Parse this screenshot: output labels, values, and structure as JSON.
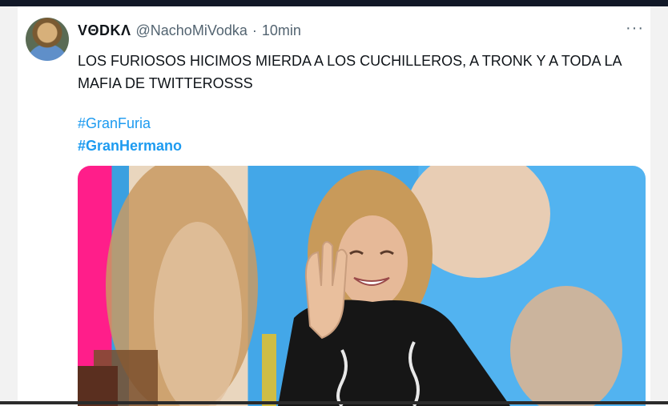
{
  "tweet": {
    "display_name": "VΘDKΛ",
    "handle": "@NachoMiVodka",
    "separator": "·",
    "time": "10min",
    "more": "···",
    "text": "LOS FURIOSOS HICIMOS MIERDA A LOS CUCHILLEROS, A TRONK Y A TODA LA MAFIA DE TWITTEROSSS",
    "hashtags": [
      "#GranFuria",
      "#GranHermano"
    ]
  },
  "icons": {
    "more": "more-options-icon",
    "avatar": "avatar"
  },
  "colors": {
    "hashtag": "#1d9bf0",
    "muted": "#536471",
    "text": "#0f1419"
  }
}
